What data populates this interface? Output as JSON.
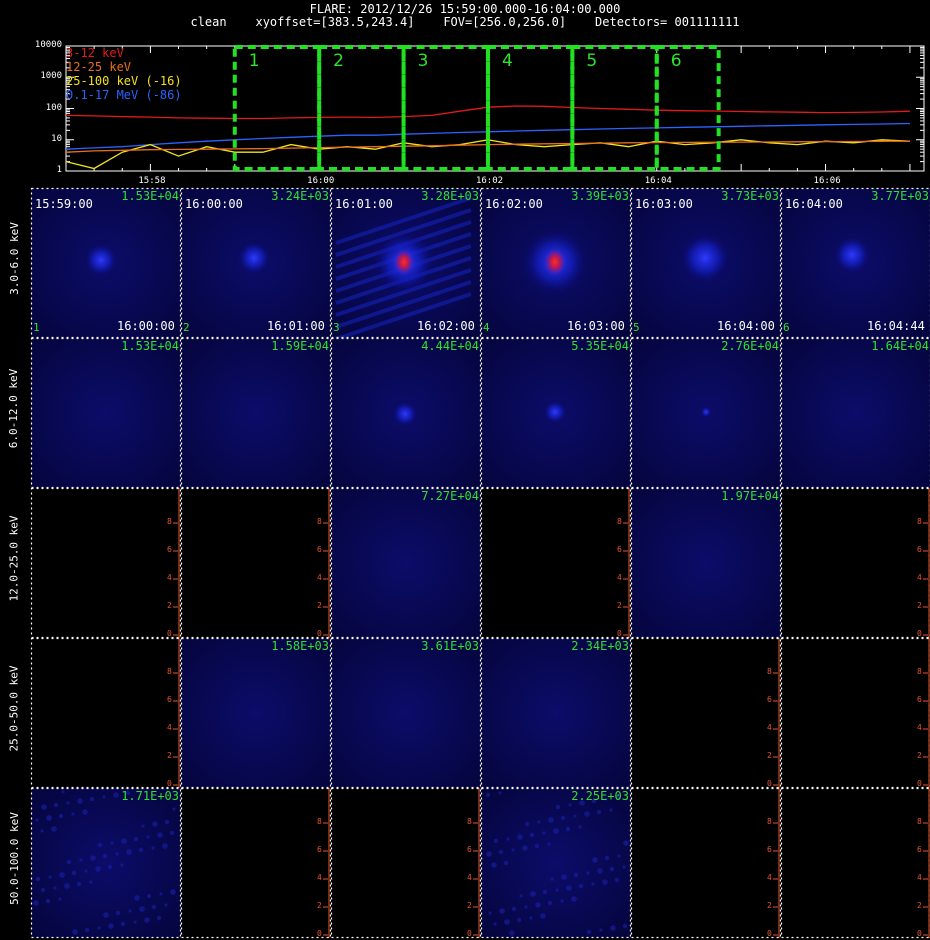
{
  "header": {
    "line1": "FLARE: 2012/12/26 15:59:00.000-16:04:00.000",
    "line2": "clean    xyoffset=[383.5,243.4]    FOV=[256.0,256.0]    Detectors= 001111111"
  },
  "chart_data": [
    {
      "type": "line",
      "title": "",
      "xlabel": "",
      "ylabel": "",
      "yscale": "log",
      "ylim": [
        1,
        10000
      ],
      "xlim": [
        "15:57:00",
        "16:07:10"
      ],
      "x_ticks": [
        "15:58",
        "16:00",
        "16:02",
        "16:04",
        "16:06"
      ],
      "y_ticks": [
        "1",
        "10",
        "100",
        "1000",
        "10000"
      ],
      "grid": false,
      "legend": "top-left",
      "x": [
        "15:57:00",
        "15:57:20",
        "15:57:40",
        "15:58:00",
        "15:58:20",
        "15:58:40",
        "15:59:00",
        "15:59:20",
        "15:59:40",
        "16:00:00",
        "16:00:20",
        "16:00:40",
        "16:01:00",
        "16:01:20",
        "16:01:40",
        "16:02:00",
        "16:02:20",
        "16:02:40",
        "16:03:00",
        "16:03:20",
        "16:03:40",
        "16:04:00",
        "16:04:20",
        "16:04:40",
        "16:05:00",
        "16:05:20",
        "16:05:40",
        "16:06:00",
        "16:06:20",
        "16:06:40",
        "16:07:00"
      ],
      "series": [
        {
          "name": "3-12 keV",
          "color": "#e21a1a",
          "values": [
            60,
            58,
            55,
            53,
            50,
            49,
            48,
            48,
            50,
            52,
            53,
            52,
            55,
            60,
            82,
            110,
            120,
            118,
            108,
            100,
            94,
            88,
            85,
            83,
            80,
            78,
            76,
            74,
            75,
            77,
            82
          ]
        },
        {
          "name": "12-25 keV",
          "color": "#e86d1f",
          "values": [
            4,
            4.4,
            4.6,
            4.8,
            4.9,
            5,
            5.1,
            5.2,
            5.4,
            5.6,
            5.8,
            6,
            6.2,
            6.4,
            6.7,
            7,
            7.2,
            7.4,
            7.6,
            7.8,
            8,
            8.1,
            8.2,
            8.3,
            8.4,
            8.5,
            8.6,
            8.7,
            8.8,
            8.9,
            9
          ]
        },
        {
          "name": "25-100 keV (-16)",
          "color": "#f2e21a",
          "values": [
            2,
            1.2,
            4,
            7,
            3,
            6,
            4,
            4,
            7,
            5,
            6,
            5,
            8,
            6,
            7,
            10,
            7,
            6,
            7,
            8,
            6,
            9,
            7,
            8,
            10,
            8,
            7,
            9,
            8,
            10,
            9
          ]
        },
        {
          "name": "0.1-17 MeV (-86)",
          "color": "#2a63ff",
          "values": [
            5,
            5.5,
            6,
            7,
            8,
            9,
            10,
            11,
            12,
            13,
            14,
            14,
            15,
            16,
            17,
            18,
            19,
            20,
            21,
            22,
            23,
            24,
            25,
            26,
            27,
            28,
            29,
            30,
            31,
            32,
            33
          ]
        }
      ],
      "intervals": [
        {
          "label": "1",
          "start": "15:59:00",
          "end": "16:00:00"
        },
        {
          "label": "2",
          "start": "16:00:00",
          "end": "16:01:00"
        },
        {
          "label": "3",
          "start": "16:01:00",
          "end": "16:02:00"
        },
        {
          "label": "4",
          "start": "16:02:00",
          "end": "16:03:00"
        },
        {
          "label": "5",
          "start": "16:03:00",
          "end": "16:04:00"
        },
        {
          "label": "6",
          "start": "16:04:00",
          "end": "16:04:44"
        }
      ]
    },
    {
      "type": "heatmap",
      "energy_bands": [
        "3.0-6.0 keV",
        "6.0-12.0 keV",
        "12.0-25.0 keV",
        "25.0-50.0 keV",
        "50.0-100.0 keV"
      ],
      "time_starts": [
        "15:59:00",
        "16:00:00",
        "16:01:00",
        "16:02:00",
        "16:03:00",
        "16:04:00"
      ],
      "time_ends": [
        "16:00:00",
        "16:01:00",
        "16:02:00",
        "16:03:00",
        "16:04:00",
        "16:04:44"
      ],
      "interval_numbers": [
        "1",
        "2",
        "3",
        "4",
        "5",
        "6"
      ],
      "axis_ticks": [
        "0",
        "2",
        "4",
        "6",
        "8"
      ],
      "axis_tick_color": "#e8552a",
      "cells": [
        [
          {
            "max": "1.53E+04",
            "kind": "source"
          },
          {
            "max": "3.24E+03",
            "kind": "source"
          },
          {
            "max": "3.28E+03",
            "kind": "source"
          },
          {
            "max": "3.39E+03",
            "kind": "source"
          },
          {
            "max": "3.73E+03",
            "kind": "source"
          },
          {
            "max": "3.77E+03",
            "kind": "source"
          }
        ],
        [
          {
            "max": "1.53E+04",
            "kind": "flat"
          },
          {
            "max": "1.59E+04",
            "kind": "flat"
          },
          {
            "max": "4.44E+04",
            "kind": "source"
          },
          {
            "max": "5.35E+04",
            "kind": "source"
          },
          {
            "max": "2.76E+04",
            "kind": "source"
          },
          {
            "max": "1.64E+04",
            "kind": "flat"
          }
        ],
        [
          {
            "max": "",
            "kind": "empty"
          },
          {
            "max": "",
            "kind": "empty"
          },
          {
            "max": "7.27E+04",
            "kind": "flat"
          },
          {
            "max": "",
            "kind": "empty"
          },
          {
            "max": "1.97E+04",
            "kind": "flat"
          },
          {
            "max": "",
            "kind": "empty"
          }
        ],
        [
          {
            "max": "",
            "kind": "empty"
          },
          {
            "max": "1.58E+03",
            "kind": "flat"
          },
          {
            "max": "3.61E+03",
            "kind": "flat"
          },
          {
            "max": "2.34E+03",
            "kind": "flat"
          },
          {
            "max": "",
            "kind": "empty"
          },
          {
            "max": "",
            "kind": "empty"
          }
        ],
        [
          {
            "max": "1.71E+03",
            "kind": "noise"
          },
          {
            "max": "",
            "kind": "empty"
          },
          {
            "max": "",
            "kind": "empty"
          },
          {
            "max": "2.25E+03",
            "kind": "noise"
          },
          {
            "max": "",
            "kind": "empty"
          },
          {
            "max": "",
            "kind": "empty"
          }
        ]
      ]
    }
  ]
}
